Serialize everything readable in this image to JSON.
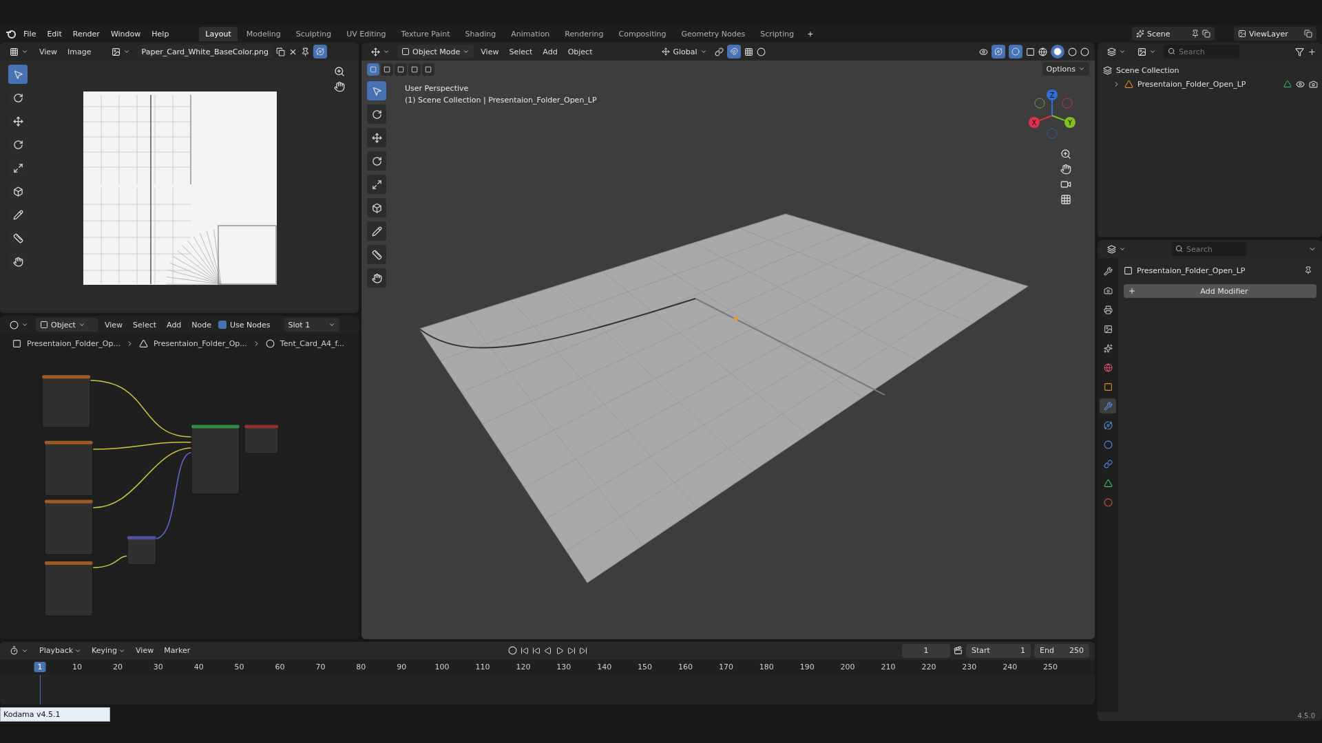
{
  "menu_bar": {
    "menus": [
      "File",
      "Edit",
      "Render",
      "Window",
      "Help"
    ],
    "workspaces": [
      {
        "label": "Layout",
        "selected": true
      },
      {
        "label": "Modeling",
        "selected": false
      },
      {
        "label": "Sculpting",
        "selected": false
      },
      {
        "label": "UV Editing",
        "selected": false
      },
      {
        "label": "Texture Paint",
        "selected": false
      },
      {
        "label": "Shading",
        "selected": false
      },
      {
        "label": "Animation",
        "selected": false
      },
      {
        "label": "Rendering",
        "selected": false
      },
      {
        "label": "Compositing",
        "selected": false
      },
      {
        "label": "Geometry Nodes",
        "selected": false
      },
      {
        "label": "Scripting",
        "selected": false
      }
    ],
    "add_workspace": "+",
    "scene": "Scene",
    "view_layer": "ViewLayer"
  },
  "image_editor": {
    "menus": [
      "View",
      "Image"
    ],
    "image_name": "Paper_Card_White_BaseColor.png"
  },
  "node_editor": {
    "object_type": "Object",
    "menus": [
      "View",
      "Select",
      "Add",
      "Node"
    ],
    "use_nodes": {
      "label": "Use Nodes",
      "checked": true
    },
    "slot": "Slot 1",
    "breadcrumbs": [
      {
        "kind": "object",
        "label": "Presentaion_Folder_Op..."
      },
      {
        "kind": "mesh",
        "label": "Presentaion_Folder_Op..."
      },
      {
        "kind": "material",
        "label": "Tent_Card_A4_f..."
      }
    ]
  },
  "viewport": {
    "mode": "Object Mode",
    "menus": [
      "View",
      "Select",
      "Add",
      "Object"
    ],
    "orientation": "Global",
    "options": "Options",
    "overlay_lines": [
      "User Perspective",
      "(1) Scene Collection | Presentaion_Folder_Open_LP"
    ],
    "axes": [
      {
        "label": "Z",
        "color": "#2f6fd6"
      },
      {
        "label": "X",
        "color": "#e0304a"
      },
      {
        "label": "Y",
        "color": "#80c020"
      }
    ]
  },
  "outliner": {
    "search_placeholder": "Search",
    "items": [
      {
        "label": "Scene Collection",
        "children": [
          {
            "label": "Presentaion_Folder_Open_LP",
            "expanded": false
          }
        ]
      }
    ]
  },
  "properties": {
    "search_placeholder": "Search",
    "object_name": "Presentaion_Folder_Open_LP",
    "add_modifier": "Add Modifier",
    "tabs": [
      {
        "kind": "tool",
        "selected": false
      },
      {
        "kind": "render",
        "selected": false
      },
      {
        "kind": "output",
        "selected": false
      },
      {
        "kind": "view",
        "selected": false
      },
      {
        "kind": "scene",
        "selected": false
      },
      {
        "kind": "world",
        "selected": false
      },
      {
        "kind": "object",
        "selected": false
      },
      {
        "kind": "modifier",
        "selected": true
      },
      {
        "kind": "particles",
        "selected": false
      },
      {
        "kind": "physics",
        "selected": false
      },
      {
        "kind": "constraint",
        "selected": false
      },
      {
        "kind": "data",
        "selected": false
      },
      {
        "kind": "material",
        "selected": false
      }
    ]
  },
  "timeline": {
    "menus": [
      "Playback",
      "Keying",
      "View",
      "Marker"
    ],
    "current_frame": "1",
    "start_label": "Start",
    "start": "1",
    "end_label": "End",
    "end": "250",
    "playhead": "1",
    "ticks": [
      "10",
      "20",
      "30",
      "40",
      "50",
      "60",
      "70",
      "80",
      "90",
      "100",
      "110",
      "120",
      "130",
      "140",
      "150",
      "160",
      "170",
      "180",
      "190",
      "200",
      "210",
      "220",
      "230",
      "240",
      "250"
    ]
  },
  "status_bar": {
    "addon": "Kodama v4.5.1",
    "version": "4.5.0"
  }
}
